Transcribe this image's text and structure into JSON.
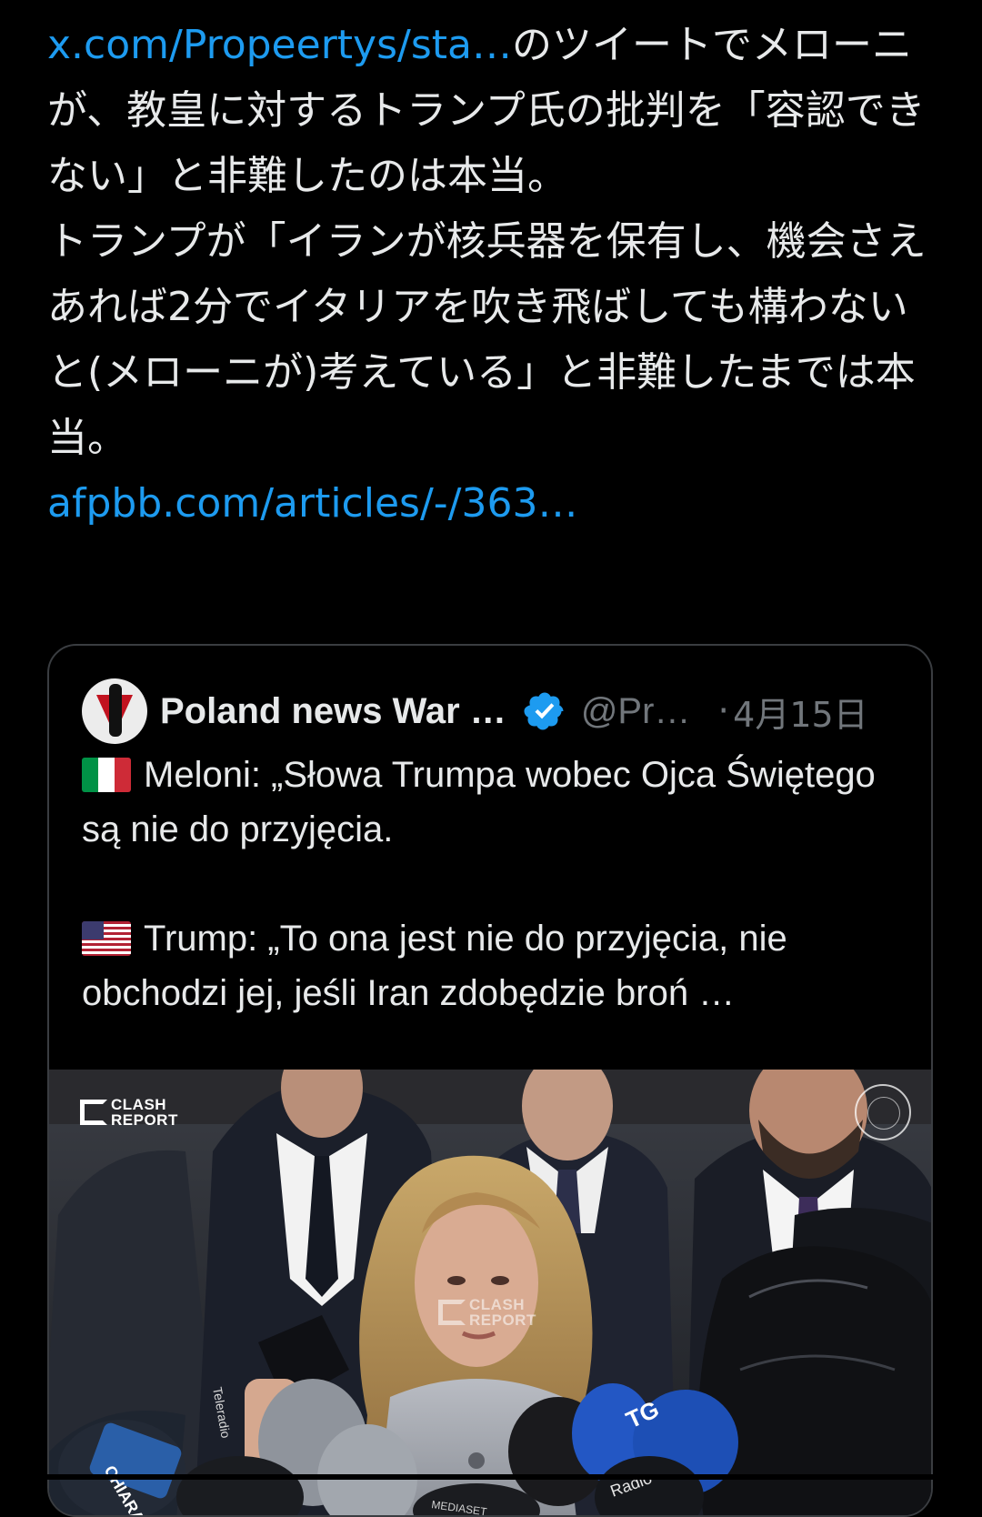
{
  "post": {
    "link1": "x.com/Propeertys/sta…",
    "text1": "のツイートでメローニが、教皇に対するトランプ氏の批判を「容認できない」と非難したのは本当。",
    "text2": "トランプが「イランが核兵器を保有し、機会さえあれば2分でイタリアを吹き飛ばしても構わないと(メローニが)考えている」と非難したまでは本当。",
    "link2": "afpbb.com/articles/-/363…"
  },
  "quote": {
    "author_name": "Poland news War …",
    "handle": "@Pr…",
    "separator": "·",
    "date": "4月15日",
    "para1": "Meloni: „Słowa Trumpa wobec Ojca Świętego są nie do przyjęcia.",
    "para2": "Trump: „To ona jest nie do przyjęcia, nie obchodzi jej, jeśli Iran zdobędzie broń …",
    "flag1": "italy-flag-icon",
    "flag2": "us-flag-icon"
  },
  "media": {
    "watermark_line1": "CLASH",
    "watermark_line2": "REPORT",
    "mic_labels": [
      "CHIARA",
      "Radio",
      "TG",
      "Radio",
      "MEDIASET",
      "Teleradio"
    ]
  },
  "colors": {
    "background": "#000000",
    "text": "#e7e9ea",
    "link": "#1d9bf0",
    "muted": "#71767b",
    "border": "#3a3d41",
    "verified": "#1d9bf0"
  }
}
